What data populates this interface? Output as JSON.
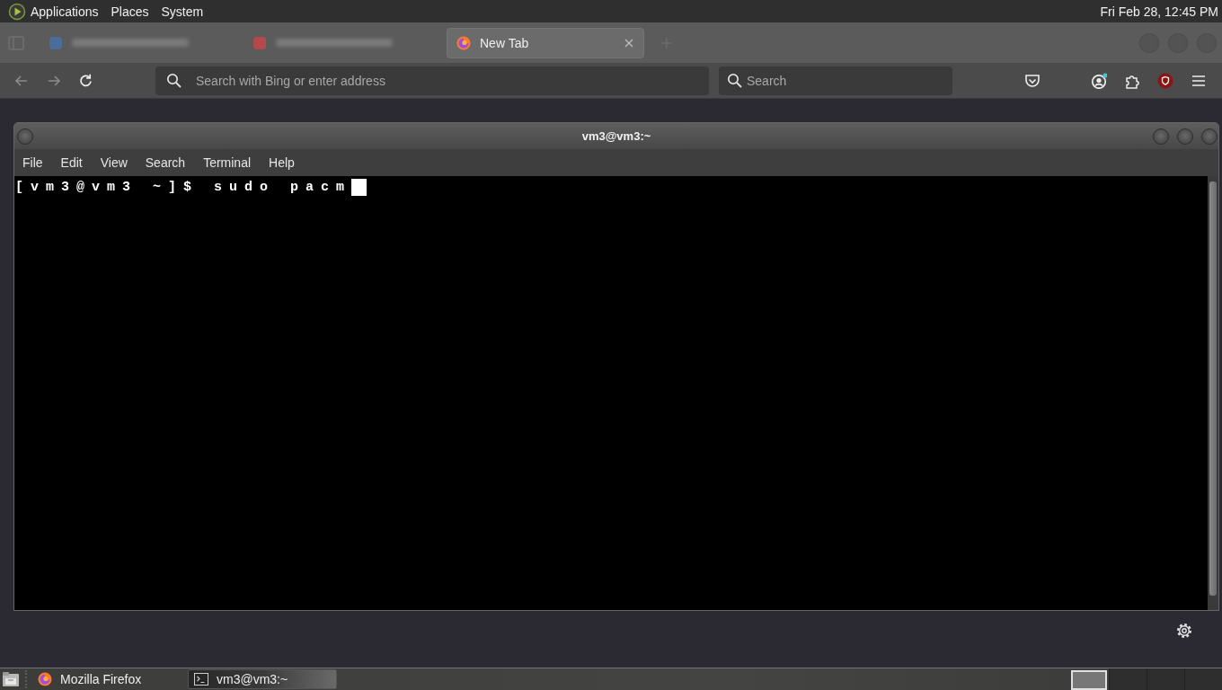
{
  "top_panel": {
    "menus": [
      "Applications",
      "Places",
      "System"
    ],
    "clock": "Fri Feb 28, 12:45 PM"
  },
  "browser": {
    "tabs": [
      {
        "kind": "blurred",
        "color": "#4a6e9a",
        "selected": false
      },
      {
        "kind": "blurred",
        "color": "#b5484a",
        "selected": false
      },
      {
        "kind": "page",
        "title": "New Tab",
        "selected": true
      }
    ],
    "nav_buttons": [
      {
        "kind": "back",
        "disabled": true
      },
      {
        "kind": "forward",
        "disabled": true
      },
      {
        "kind": "reload",
        "disabled": false
      }
    ],
    "address_bar": {
      "placeholder": "Search with Bing or enter address"
    },
    "search_bar": {
      "placeholder": "Search"
    }
  },
  "terminal": {
    "title": "vm3@vm3:~",
    "menus": [
      "File",
      "Edit",
      "View",
      "Search",
      "Terminal",
      "Help"
    ],
    "lines": [
      "[vm3@vm3 ~]$ sudo pacm"
    ]
  },
  "taskbar": {
    "tasks": [
      {
        "kind": "firefox",
        "title": "Mozilla Firefox",
        "selected": false
      },
      {
        "kind": "terminal",
        "title": "vm3@vm3:~",
        "selected": true
      }
    ],
    "workspaces": [
      {
        "selected": true
      },
      {
        "selected": false
      },
      {
        "selected": false
      },
      {
        "selected": false
      }
    ]
  }
}
